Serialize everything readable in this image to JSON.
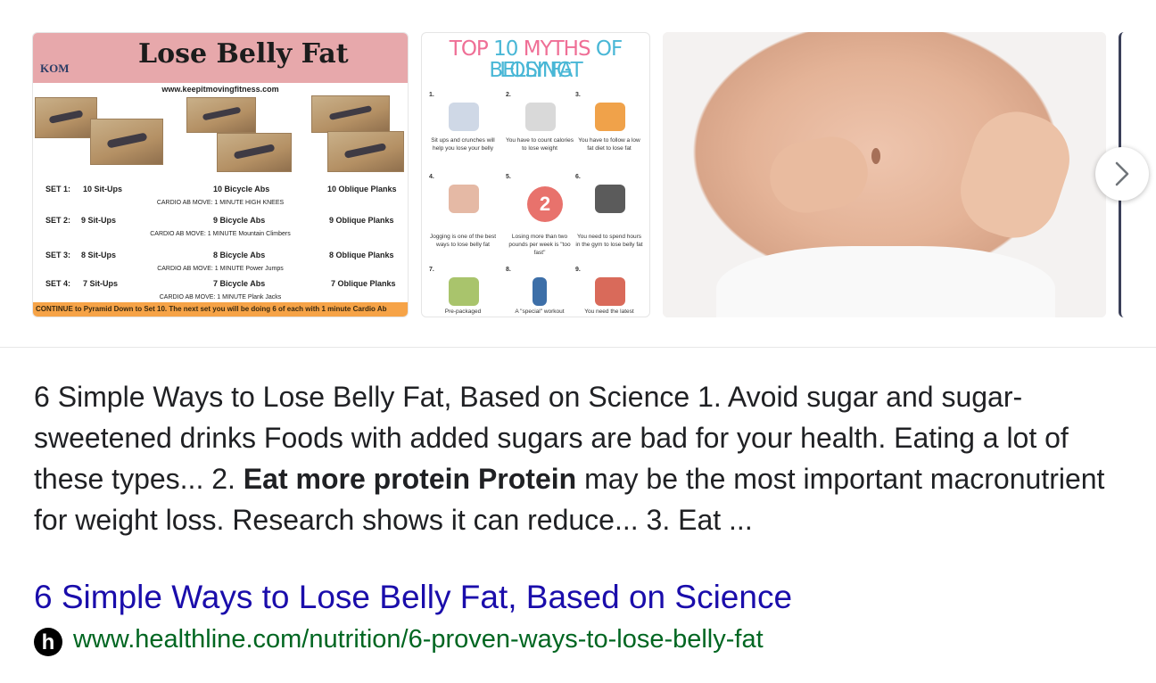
{
  "images": {
    "thumb1": {
      "logo": "KOM",
      "title": "Lose Belly Fat",
      "url": "www.keepitmovingfitness.com",
      "sets": [
        {
          "set": "SET 1:",
          "a": "10 Sit-Ups",
          "b": "10 Bicycle Abs",
          "c": "10 Oblique Planks",
          "note": "CARDIO AB MOVE: 1 MINUTE  HIGH KNEES"
        },
        {
          "set": "SET 2:",
          "a": "9 Sit-Ups",
          "b": "9 Bicycle Abs",
          "c": "9 Oblique Planks",
          "note": "CARDIO AB MOVE: 1 MINUTE  Mountain Climbers"
        },
        {
          "set": "SET 3:",
          "a": "8 Sit-Ups",
          "b": "8 Bicycle Abs",
          "c": "8 Oblique Planks",
          "note": "CARDIO AB MOVE: 1 MINUTE  Power Jumps"
        },
        {
          "set": "SET 4:",
          "a": "7 Sit-Ups",
          "b": "7 Bicycle Abs",
          "c": "7 Oblique Planks",
          "note": "CARDIO AB MOVE: 1 MINUTE  Plank Jacks"
        }
      ],
      "footer": "CONTINUE to Pyramid Down to Set 10. The next set you will be doing 6 of each with 1 minute Cardio Ab"
    },
    "thumb2": {
      "title_line1_pink": "TOP",
      "title_line1_blue_a": "10",
      "title_line1_pink_b": "MYTHS",
      "title_line1_blue_b": "OF LOSING",
      "title_line2": "BELLY FAT",
      "badge": "2",
      "cells": [
        {
          "num": "1.",
          "cap": "Sit ups and crunches will help you lose your belly"
        },
        {
          "num": "2.",
          "cap": "You have to count calories to lose weight"
        },
        {
          "num": "3.",
          "cap": "You have to follow a low fat diet to lose fat"
        },
        {
          "num": "4.",
          "cap": "Jogging is one of the best ways to lose belly fat"
        },
        {
          "num": "5.",
          "cap": "Losing more than two pounds per week is \"too fast\""
        },
        {
          "num": "6.",
          "cap": "You need to spend hours in the gym to lose belly fat"
        },
        {
          "num": "7.",
          "cap": "Pre-packaged"
        },
        {
          "num": "8.",
          "cap": "A \"special\" workout"
        },
        {
          "num": "9.",
          "cap": "You need the latest"
        }
      ]
    }
  },
  "snippet": {
    "part1": "6 Simple Ways to Lose Belly Fat, Based on Science 1. Avoid sugar and sugar-sweetened drinks Foods with added sugars are bad for your health. Eating a lot of these types... 2. ",
    "bold": "Eat more protein Protein",
    "part2": " may be the most important macronutrient for weight loss. Research shows it can reduce... 3. Eat ..."
  },
  "result": {
    "title": "6 Simple Ways to Lose Belly Fat, Based on Science",
    "favicon_letter": "h",
    "url": "www.healthline.com/nutrition/6-proven-ways-to-lose-belly-fat"
  },
  "colors": {
    "link": "#1a0dab",
    "url": "#006621",
    "text": "#202124"
  },
  "icons": {
    "next": "chevron-right-icon",
    "favicon": "healthline-favicon-icon"
  }
}
